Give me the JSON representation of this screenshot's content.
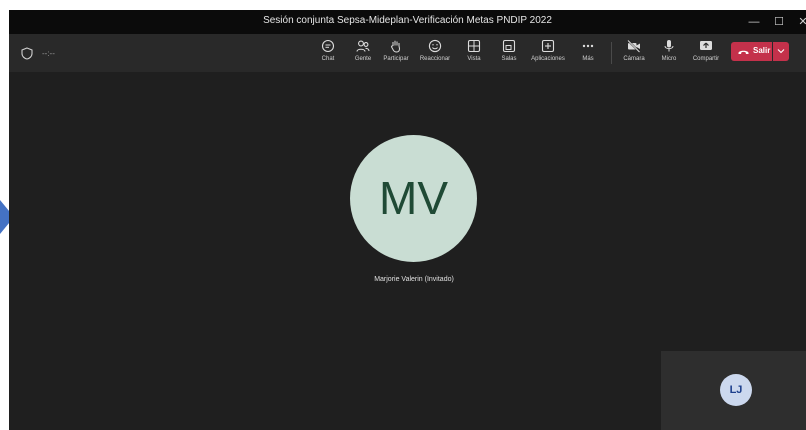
{
  "window": {
    "title": "Sesión conjunta Sepsa-Mideplan-Verificación Metas PNDIP 2022",
    "controls": {
      "minimize": "—",
      "maximize": "☐",
      "close": "✕"
    }
  },
  "toolbar": {
    "timer": "--:--",
    "buttons": {
      "chat": "Chat",
      "people": "Gente",
      "raise_hand": "Participar",
      "react": "Reaccionar",
      "view": "Vista",
      "rooms": "Salas",
      "apps": "Aplicaciones",
      "more": "Más",
      "camera": "Cámara",
      "mic": "Micro",
      "share": "Compartir"
    },
    "leave_label": "Salir"
  },
  "stage": {
    "main_participant": {
      "initials": "MV",
      "name": "Marjorie Valerin (Invitado)"
    },
    "self_tile": {
      "initials": "LJ"
    }
  },
  "colors": {
    "leave_button": "#c4314b",
    "avatar_mv_bg": "#c9ddd3",
    "avatar_mv_text": "#1f4a35",
    "avatar_lj_bg": "#ccd8ee",
    "avatar_lj_text": "#1d3f8c",
    "arrow": "#4472c4"
  }
}
